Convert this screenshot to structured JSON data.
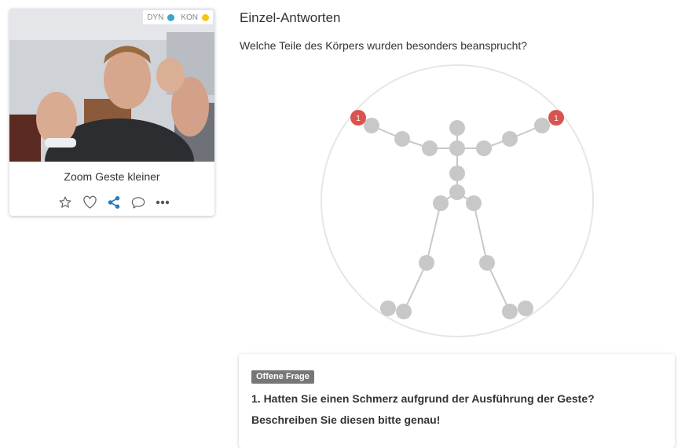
{
  "card": {
    "badges": [
      {
        "label": "DYN",
        "color": "#3aa6c9"
      },
      {
        "label": "KON",
        "color": "#f3c614"
      }
    ],
    "title": "Zoom Geste kleiner",
    "actions": [
      "star-icon",
      "heart-icon",
      "share-icon",
      "comment-icon",
      "more-icon"
    ],
    "share_color": "#2a7ab8"
  },
  "main": {
    "heading": "Einzel-Antworten",
    "question": "Welche Teile des Körpers wurden besonders beansprucht?"
  },
  "body_map": {
    "joint_color": "#c8c8c8",
    "marker_color": "#d9534f",
    "markers": [
      {
        "joint": "right-hand",
        "count": "1"
      },
      {
        "joint": "left-hand",
        "count": "1"
      }
    ]
  },
  "open_question": {
    "tag": "Offene Frage",
    "text": "1. Hatten Sie einen Schmerz aufgrund der Ausführung der Geste? Beschreiben Sie diesen bitte genau!"
  }
}
